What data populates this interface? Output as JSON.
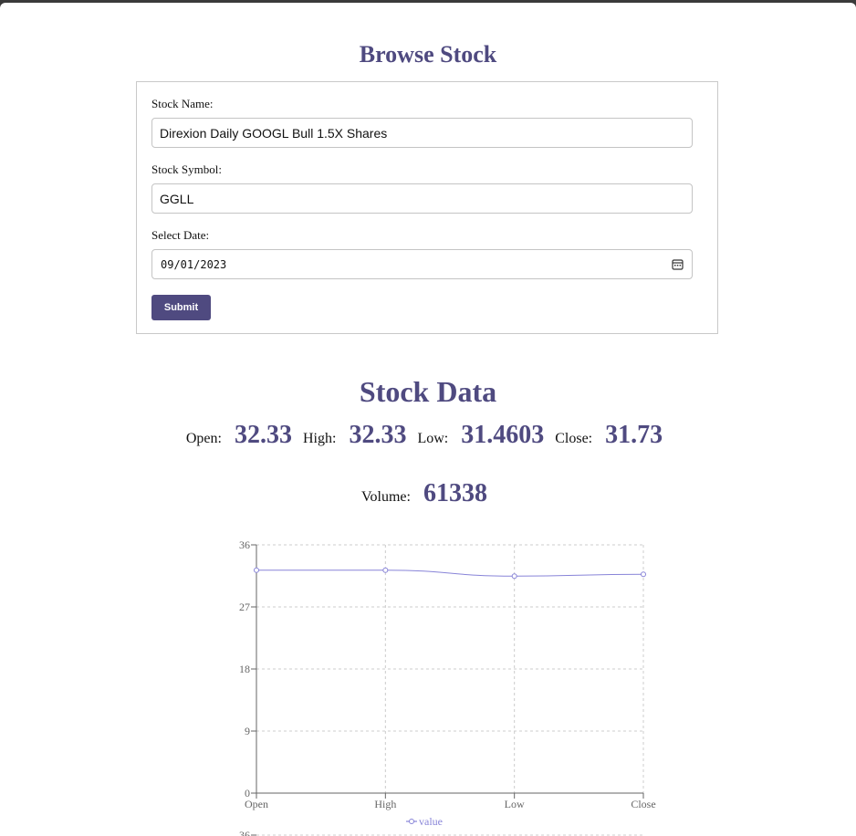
{
  "form": {
    "title": "Browse Stock",
    "stock_name_label": "Stock Name:",
    "stock_name_value": "Direxion Daily GOOGL Bull 1.5X Shares",
    "stock_symbol_label": "Stock Symbol:",
    "stock_symbol_value": "GGLL",
    "date_label": "Select Date:",
    "date_value": "09/01/2023",
    "submit_label": "Submit"
  },
  "stock_data": {
    "title": "Stock Data",
    "open_label": "Open:",
    "open_value": "32.33",
    "high_label": "High:",
    "high_value": "32.33",
    "low_label": "Low:",
    "low_value": "31.4603",
    "close_label": "Close:",
    "close_value": "31.73",
    "volume_label": "Volume:",
    "volume_value": "61338"
  },
  "colors": {
    "accent": "#4f4a80",
    "line": "#8884d8"
  },
  "chart_data": {
    "type": "line",
    "categories": [
      "Open",
      "High",
      "Low",
      "Close"
    ],
    "series": [
      {
        "name": "value",
        "values": [
          32.33,
          32.33,
          31.4603,
          31.73
        ]
      }
    ],
    "ylim": [
      0,
      36
    ],
    "yticks": [
      "0",
      "9",
      "18",
      "27",
      "36"
    ],
    "grid": true,
    "legend": "bottom"
  },
  "second_chart_partial_tick": "36"
}
